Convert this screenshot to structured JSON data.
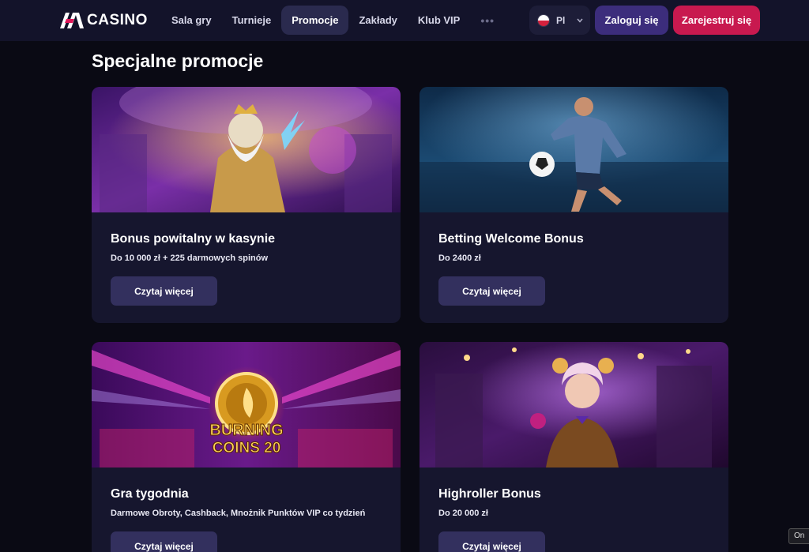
{
  "header": {
    "logo_text": "CASINO",
    "nav": [
      "Sala gry",
      "Turnieje",
      "Promocje",
      "Zakłady",
      "Klub VIP"
    ],
    "active_nav": "Promocje",
    "more": "•••",
    "language": "Pl",
    "login_label": "Zaloguj się",
    "register_label": "Zarejestruj się"
  },
  "page": {
    "title": "Specjalne promocje"
  },
  "promotions": [
    {
      "title": "Bonus powitalny w kasynie",
      "subtitle": "Do 10 000 zł + 225 darmowych spinów",
      "button": "Czytaj więcej"
    },
    {
      "title": "Betting Welcome Bonus",
      "subtitle": "Do 2400 zł",
      "button": "Czytaj więcej"
    },
    {
      "title": "Gra tygodnia",
      "subtitle": "Darmowe Obroty, Cashback, Mnożnik Punktów VIP co tydzień",
      "button": "Czytaj więcej",
      "image_text_1": "BURNING",
      "image_text_2": "COINS 20"
    },
    {
      "title": "Highroller Bonus",
      "subtitle": "Do 20 000 zł",
      "button": "Czytaj więcej"
    }
  ],
  "overlay": {
    "partial_label": "On"
  }
}
